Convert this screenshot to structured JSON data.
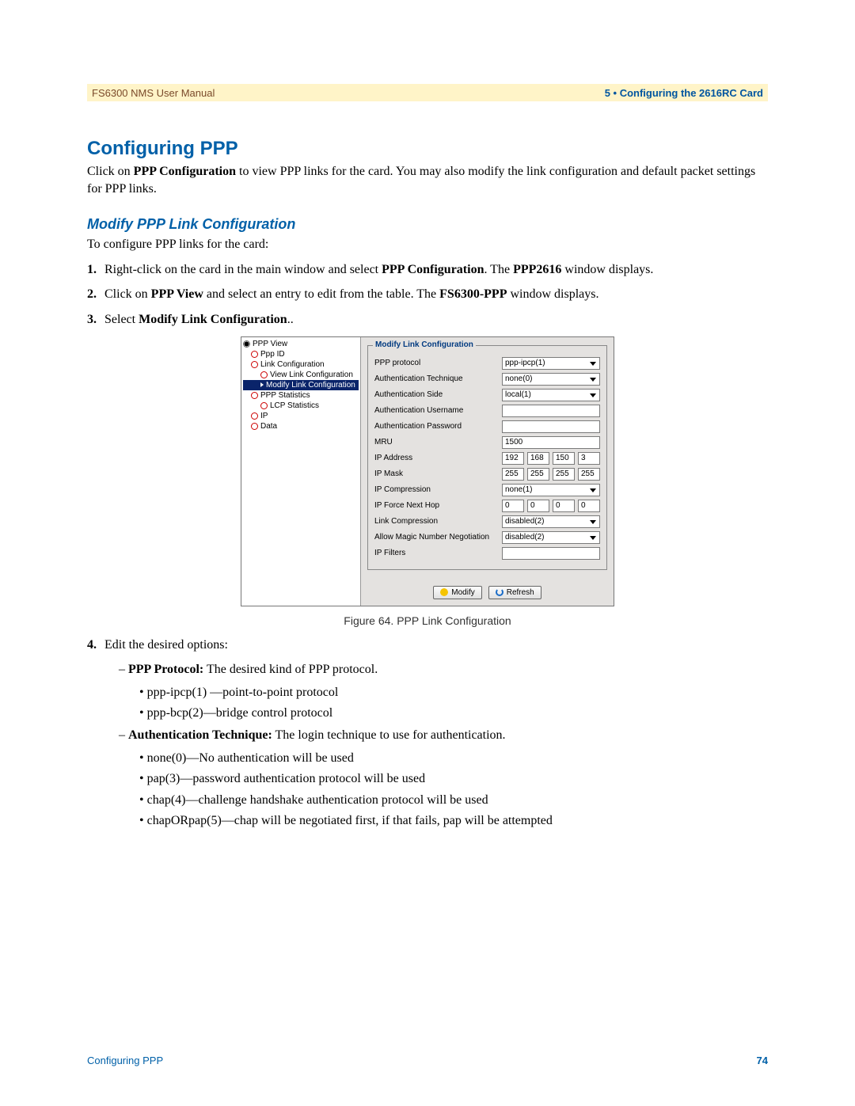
{
  "header": {
    "left": "FS6300 NMS User Manual",
    "right": "5 • Configuring the 2616RC Card"
  },
  "section_title": "Configuring PPP",
  "intro": {
    "pre": "Click on ",
    "bold": "PPP Configuration",
    "post": " to view PPP links for the card. You may also modify the link configuration and default packet settings for PPP links."
  },
  "subsection_title": "Modify PPP Link Configuration",
  "sub_intro": "To configure PPP links for the card:",
  "steps": {
    "s1_pre": "Right-click on the card in the main window and select ",
    "s1_b1": "PPP Configuration",
    "s1_mid": ". The ",
    "s1_b2": "PPP2616",
    "s1_post": " window dis­plays.",
    "s2_pre": "Click on ",
    "s2_b1": "PPP View",
    "s2_mid": " and select an entry to edit from the table. The ",
    "s2_b2": "FS6300-PPP",
    "s2_post": " window displays.",
    "s3_pre": "Select ",
    "s3_b1": "Modify Link Configuration",
    "s3_post": "..",
    "s4": "Edit the desired options:"
  },
  "options": {
    "ppp_proto_title": "PPP Protocol:",
    "ppp_proto_desc": " The desired kind of PPP protocol.",
    "ppp_proto_b1": "ppp-ipcp(1) —point-to-point protocol",
    "ppp_proto_b2": "ppp-bcp(2)—bridge control protocol",
    "auth_title": "Authentication Technique:",
    "auth_desc": " The login technique to use for authentication.",
    "auth_b1": "none(0)—No authentication will be used",
    "auth_b2": "pap(3)—password authentication protocol will be used",
    "auth_b3": "chap(4)—challenge handshake authentication protocol will be used",
    "auth_b4": "chapORpap(5)—chap will be negotiated first, if that fails, pap will be attempted"
  },
  "tree": {
    "ppp_view": "PPP View",
    "ppp_id": "Ppp ID",
    "link_conf": "Link Configuration",
    "view_link": "View Link Configuration",
    "modify_link": "Modify Link Configuration",
    "ppp_stats": "PPP Statistics",
    "lcp_stats": "LCP Statistics",
    "ip": "IP",
    "data": "Data"
  },
  "form": {
    "legend": "Modify Link Configuration",
    "rows": {
      "ppp_protocol": {
        "label": "PPP protocol",
        "value": "ppp-ipcp(1)"
      },
      "auth_tech": {
        "label": "Authentication Technique",
        "value": "none(0)"
      },
      "auth_side": {
        "label": "Authentication Side",
        "value": "local(1)"
      },
      "auth_user": {
        "label": "Authentication Username",
        "value": ""
      },
      "auth_pass": {
        "label": "Authentication Password",
        "value": ""
      },
      "mru": {
        "label": "MRU",
        "value": "1500"
      },
      "ip_addr": {
        "label": "IP Address",
        "oct": [
          "192",
          "168",
          "150",
          "3"
        ]
      },
      "ip_mask": {
        "label": "IP Mask",
        "oct": [
          "255",
          "255",
          "255",
          "255"
        ]
      },
      "ip_comp": {
        "label": "IP Compression",
        "value": "none(1)"
      },
      "ip_next": {
        "label": "IP Force Next Hop",
        "oct": [
          "0",
          "0",
          "0",
          "0"
        ]
      },
      "link_comp": {
        "label": "Link Compression",
        "value": "disabled(2)"
      },
      "magic": {
        "label": "Allow Magic Number Negotiation",
        "value": "disabled(2)"
      },
      "ip_filters": {
        "label": "IP Filters",
        "value": ""
      }
    },
    "buttons": {
      "modify": "Modify",
      "refresh": "Refresh"
    }
  },
  "figure_caption": "Figure 64. PPP Link Configuration",
  "footer": {
    "left": "Configuring PPP",
    "right": "74"
  }
}
